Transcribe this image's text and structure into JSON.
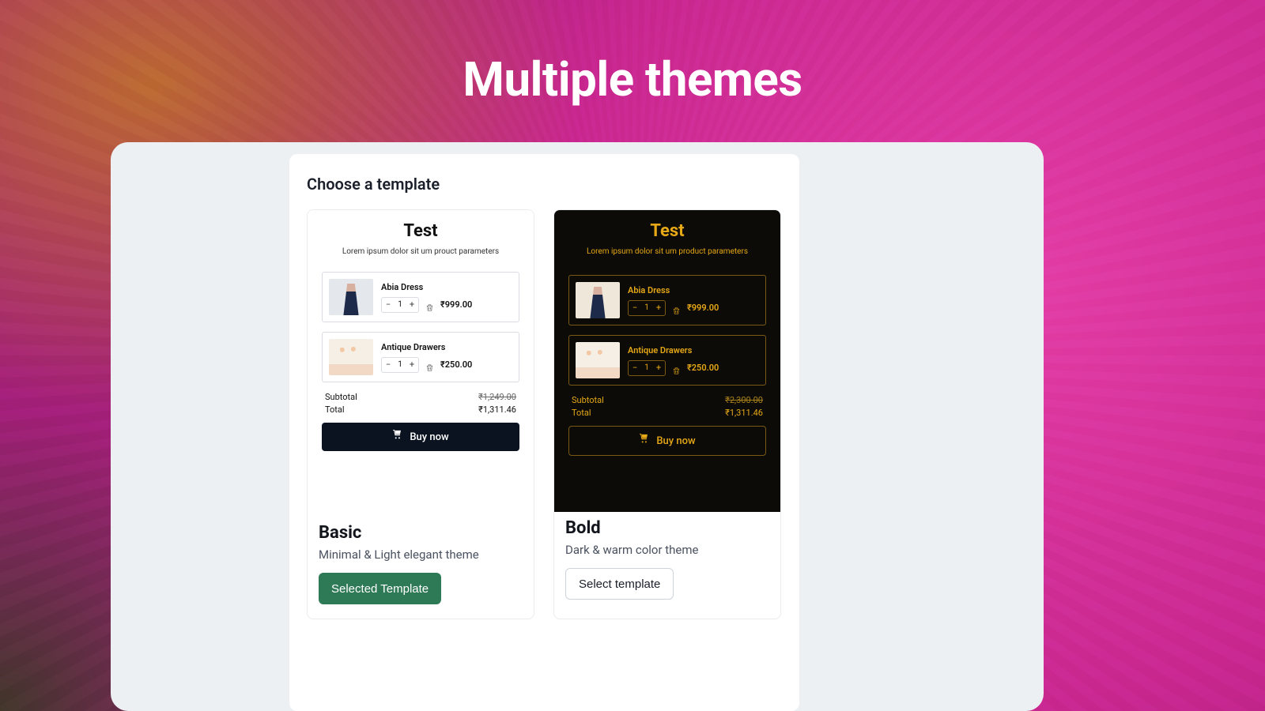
{
  "hero": {
    "title": "Multiple themes"
  },
  "choose_label": "Choose a template",
  "preview": {
    "title": "Test",
    "subtitle_light": "Lorem ipsum dolor sit um prouct parameters",
    "subtitle_dark": "Lorem ipsum dolor sit um product parameters",
    "items": [
      {
        "name": "Abia Dress",
        "qty": "1",
        "price": "₹999.00"
      },
      {
        "name": "Antique Drawers",
        "qty": "1",
        "price": "₹250.00"
      }
    ],
    "subtotal_label": "Subtotal",
    "subtotal_strike_light": "₹1,249.00",
    "subtotal_strike_dark": "₹2,300.00",
    "total_label": "Total",
    "total_value": "₹1,311.46",
    "buy_label": "Buy now"
  },
  "templates": {
    "basic": {
      "title": "Basic",
      "desc": "Minimal & Light elegant theme",
      "button": "Selected Template"
    },
    "bold": {
      "title": "Bold",
      "desc": "Dark & warm color theme",
      "button": "Select template"
    }
  }
}
